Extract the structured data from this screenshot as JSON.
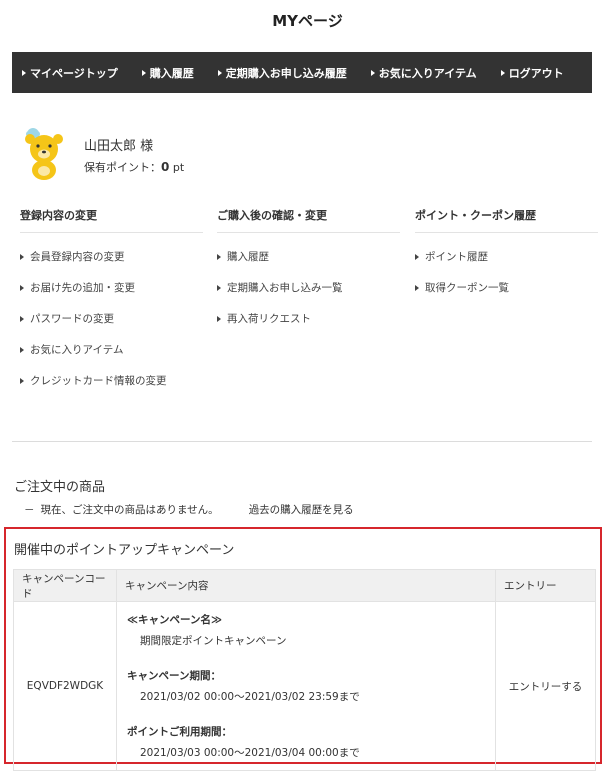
{
  "page": {
    "title": "MYページ"
  },
  "nav": {
    "items": [
      "マイページトップ",
      "購入履歴",
      "定期購入お申し込み履歴",
      "お気に入りアイテム",
      "ログアウト"
    ]
  },
  "profile": {
    "name": "山田太郎 様",
    "points_label": "保有ポイント：",
    "points_value": "0",
    "points_unit": "pt"
  },
  "menu": {
    "col1": {
      "heading": "登録内容の変更",
      "links": [
        "会員登録内容の変更",
        "お届け先の追加・変更",
        "パスワードの変更",
        "お気に入りアイテム",
        "クレジットカード情報の変更"
      ]
    },
    "col2": {
      "heading": "ご購入後の確認・変更",
      "links": [
        "購入履歴",
        "定期購入お申し込み一覧",
        "再入荷リクエスト"
      ]
    },
    "col3": {
      "heading": "ポイント・クーポン履歴",
      "links": [
        "ポイント履歴",
        "取得クーポン一覧"
      ]
    }
  },
  "orders": {
    "heading": "ご注文中の商品",
    "dash": "－",
    "none_text": "現在、ご注文中の商品はありません。",
    "history_link": "過去の購入履歴を見る"
  },
  "campaign": {
    "heading": "開催中のポイントアップキャンペーン",
    "columns": [
      "キャンペーンコード",
      "キャンペーン内容",
      "エントリー"
    ],
    "row": {
      "code": "EQVDF2WDGK",
      "name_label": "≪キャンペーン名≫",
      "name_value": "期間限定ポイントキャンペーン",
      "period_label": "キャンペーン期間：",
      "period_value": "2021/03/02 00:00～2021/03/02 23:59まで",
      "use_label": "ポイントご利用期間：",
      "use_value": "2021/03/03 00:00～2021/03/04 00:00まで",
      "entry": "エントリーする"
    }
  },
  "colors": {
    "nav_bg": "#333333",
    "highlight_border": "#d6262c",
    "table_header_bg": "#f0f0f0",
    "bear": "#f5c518"
  },
  "icons": {
    "avatar": "bear-mascot-icon",
    "bullet": "triangle-right-icon"
  }
}
